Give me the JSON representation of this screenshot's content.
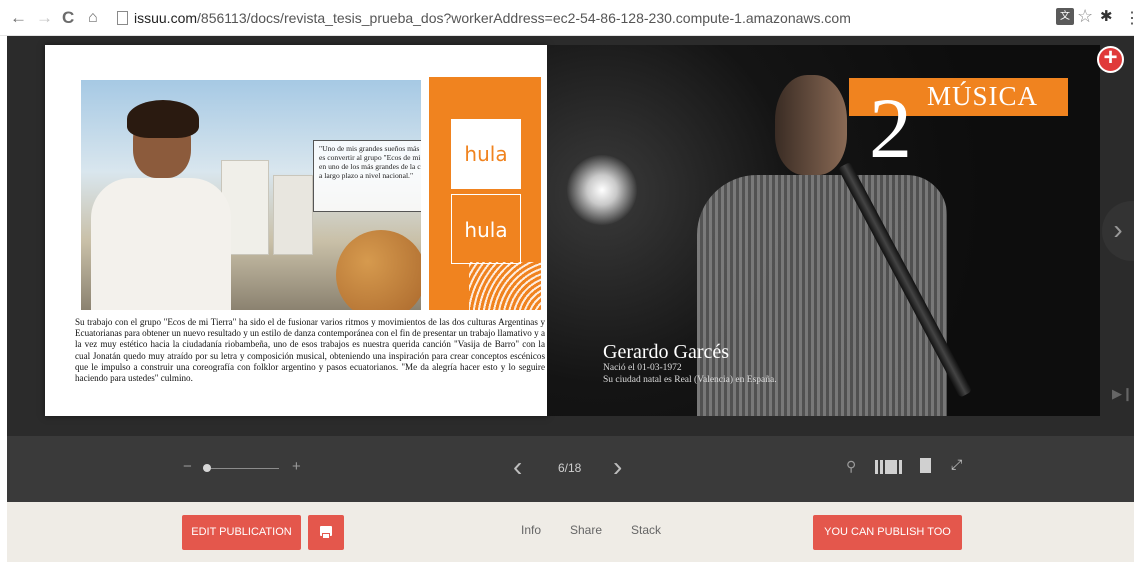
{
  "browser": {
    "url_host": "issuu.com",
    "url_path": "/856113/docs/revista_tesis_prueba_dos?workerAddress=ec2-54-86-128-230.compute-1.amazonaws.com",
    "icons": [
      "back-icon",
      "forward-icon",
      "reload-icon",
      "home-icon",
      "page-icon",
      "translate-icon",
      "star-icon",
      "extension-icon",
      "menu-icon"
    ]
  },
  "left_page": {
    "quote": "\"Uno de mis grandes sueños más grandes es convertir al grupo \"Ecos de mi Tierra\" en uno de los más grandes de la ciudad y a largo plazo a nivel nacional.\"",
    "brand_logo_1": "hula",
    "brand_logo_2": "hula",
    "body": "Su trabajo con el grupo \"Ecos de mi Tierra\" ha sido el de fusionar varios ritmos y movimientos de las dos culturas Argentinas y Ecuatorianas para obtener un nuevo resultado y un estilo de danza contemporánea con el fin de presentar un trabajo llamativo y a la vez muy estético hacia la ciudadanía riobambeña, uno de esos trabajos es nuestra querida canción \"Vasija de Barro\" con la cual Jonatán quedo muy atraído por su letra y composición musical, obteniendo una inspiración para crear conceptos escénicos que le impulso a construir una coreografía con folklor argentino y pasos ecuatorianos. \"Me da alegría hacer esto y lo seguire haciendo para ustedes\" culmino."
  },
  "right_page": {
    "section_number": "2",
    "section_title": "MÚSICA",
    "name": "Gerardo Garcés",
    "born": "Nació el 01-03-1972",
    "city": "Su ciudad natal es Real (Valencia) en España."
  },
  "controls": {
    "zoom_minus": "−",
    "zoom_plus": "+",
    "zoom_level": 0.05,
    "page_indicator": "6/18"
  },
  "footer": {
    "edit_label": "EDIT PUBLICATION",
    "info_label": "Info",
    "share_label": "Share",
    "stack_label": "Stack",
    "publish_label": "YOU CAN PUBLISH TOO"
  },
  "colors": {
    "accent_orange": "#f0831f",
    "button_red": "#e4574c",
    "stage_dark": "#2b2b2b",
    "footer_bg": "#efece6"
  }
}
